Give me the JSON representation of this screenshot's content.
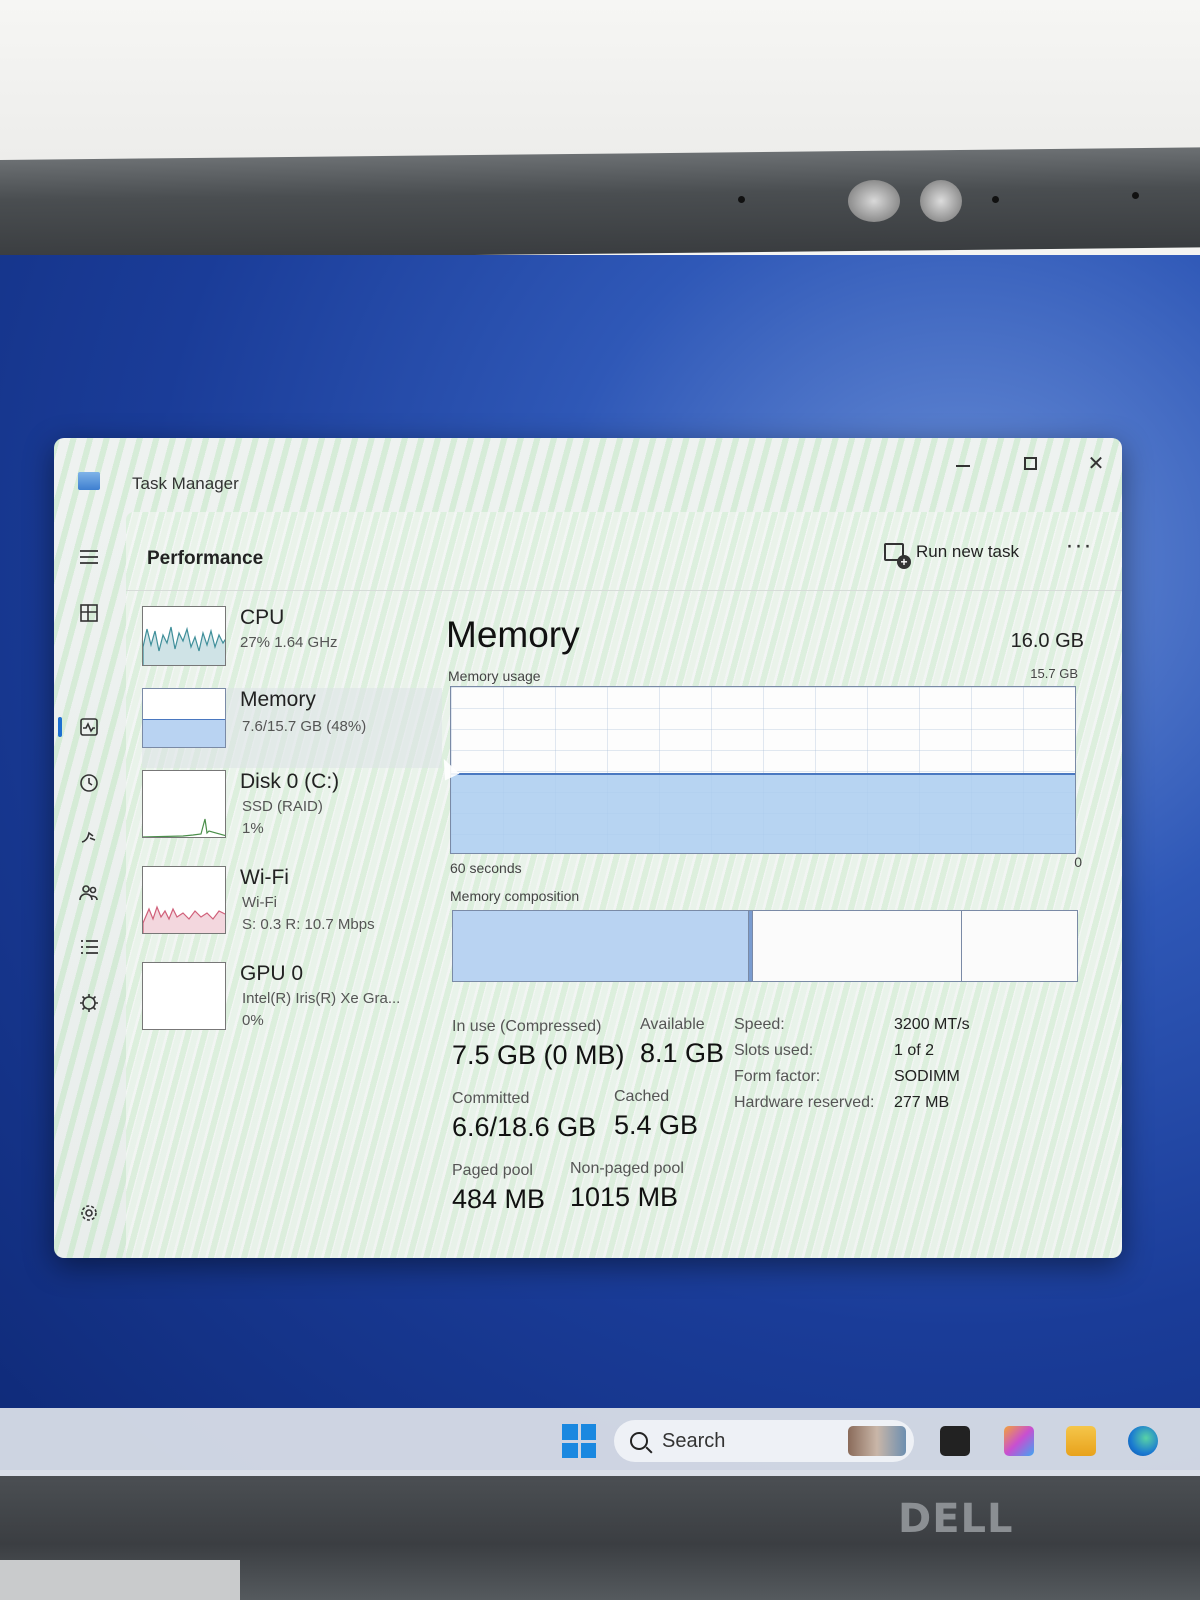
{
  "window": {
    "title": "Task Manager",
    "page_title": "Performance",
    "run_new_task_label": "Run new task",
    "more_label": "···"
  },
  "nav": {
    "items": [
      {
        "name": "hamburger-menu-icon"
      },
      {
        "name": "processes-icon"
      },
      {
        "name": "performance-icon",
        "selected": true
      },
      {
        "name": "app-history-icon"
      },
      {
        "name": "startup-apps-icon"
      },
      {
        "name": "users-icon"
      },
      {
        "name": "details-icon"
      },
      {
        "name": "services-icon"
      },
      {
        "name": "settings-icon"
      }
    ]
  },
  "devices": [
    {
      "name": "CPU",
      "line1": "27%  1.64 GHz",
      "line2": ""
    },
    {
      "name": "Memory",
      "line1": "7.6/15.7 GB (48%)",
      "line2": "",
      "selected": true
    },
    {
      "name": "Disk 0 (C:)",
      "line1": "SSD (RAID)",
      "line2": "1%"
    },
    {
      "name": "Wi-Fi",
      "line1": "Wi-Fi",
      "line2": "S: 0.3  R: 10.7 Mbps"
    },
    {
      "name": "GPU 0",
      "line1": "Intel(R) Iris(R) Xe Gra...",
      "line2": "0%"
    }
  ],
  "memory": {
    "title": "Memory",
    "total": "16.0 GB",
    "usage_label": "Memory usage",
    "usage_max": "15.7 GB",
    "usage_fraction": 0.48,
    "time_label": "60 seconds",
    "zero_label": "0",
    "composition_label": "Memory composition",
    "composition": [
      {
        "name": "in-use",
        "fraction": 0.475,
        "color": "#b9d3f2"
      },
      {
        "name": "modified",
        "fraction": 0.005,
        "color": "#7a9cd0"
      },
      {
        "name": "standby",
        "fraction": 0.335,
        "color": "#fbfbfb"
      },
      {
        "name": "free",
        "fraction": 0.185,
        "color": "#fbfbfb"
      }
    ],
    "stats": {
      "in_use_label": "In use (Compressed)",
      "in_use_value": "7.5 GB (0 MB)",
      "available_label": "Available",
      "available_value": "8.1 GB",
      "committed_label": "Committed",
      "committed_value": "6.6/18.6 GB",
      "cached_label": "Cached",
      "cached_value": "5.4 GB",
      "paged_label": "Paged pool",
      "paged_value": "484 MB",
      "nonpaged_label": "Non-paged pool",
      "nonpaged_value": "1015 MB"
    },
    "props": [
      {
        "key": "Speed:",
        "value": "3200 MT/s"
      },
      {
        "key": "Slots used:",
        "value": "1 of 2"
      },
      {
        "key": "Form factor:",
        "value": "SODIMM"
      },
      {
        "key": "Hardware reserved:",
        "value": "277 MB"
      }
    ]
  },
  "taskbar": {
    "search_label": "Search"
  },
  "laptop": {
    "brand": "DELL"
  },
  "colors": {
    "accent": "#1d6fd1",
    "memory_fill": "#b9d3f2",
    "wifi_line": "#d0607a",
    "cpu_line": "#3f8f9a"
  }
}
